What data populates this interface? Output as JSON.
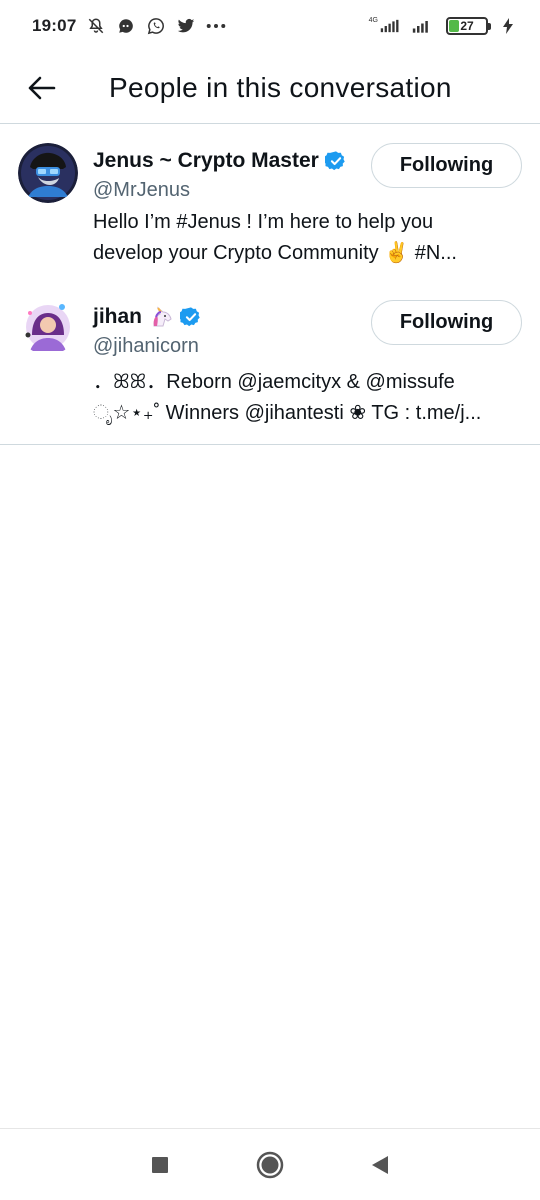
{
  "status_bar": {
    "time": "19:07",
    "network_label": "4G",
    "battery_level": "27",
    "battery_fraction": 0.27,
    "icons": [
      "notification-muted-icon",
      "chat-icon",
      "whatsapp-icon",
      "twitter-icon",
      "more-icon"
    ]
  },
  "header": {
    "title": "People in this conversation",
    "back_icon": "arrow-left-icon"
  },
  "people": [
    {
      "name": "Jenus ~ Crypto Master",
      "handle": "@MrJenus",
      "verified": true,
      "bio_line1": "Hello I’m #Jenus ! I’m here to help you",
      "bio_line2": "develop your Crypto Community ✌️ #N...",
      "follow_label": "Following"
    },
    {
      "name": "jihan",
      "name_emoji": "unicorn",
      "handle": "@jihanicorn",
      "verified": true,
      "bio_line1": "．ꕤꕤ．Reborn @jaemcityx & @missufe",
      "bio_line2": "ೃ☆⋆₊˚ Winners @jihantesti ❀ TG : t.me/j...",
      "follow_label": "Following"
    }
  ],
  "colors": {
    "verified": "#1d9bf0",
    "text_primary": "#0f1419",
    "text_secondary": "#536471",
    "border": "#cfd9de",
    "battery": "#54b948"
  },
  "nav_bar": {
    "buttons": [
      "recent-apps-icon",
      "home-icon",
      "back-triangle-icon"
    ]
  }
}
